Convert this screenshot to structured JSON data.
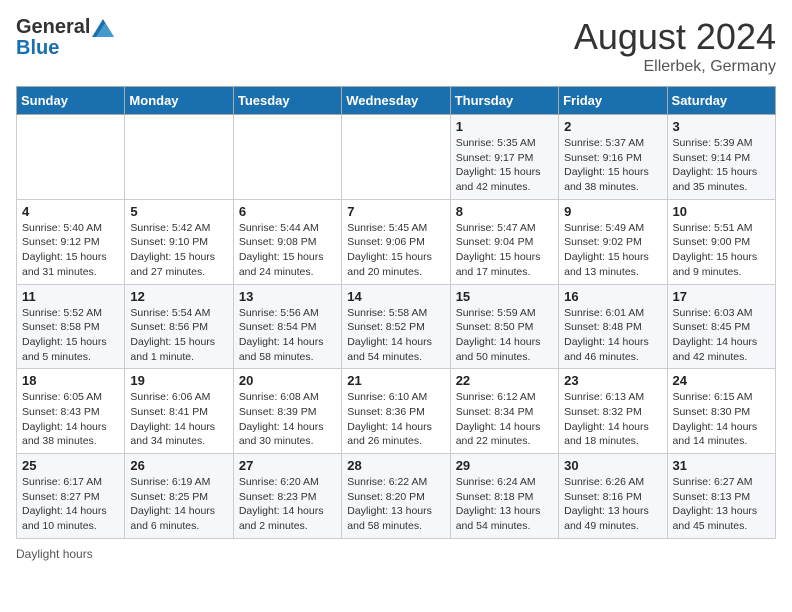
{
  "header": {
    "logo_general": "General",
    "logo_blue": "Blue",
    "month_year": "August 2024",
    "location": "Ellerbek, Germany"
  },
  "days_of_week": [
    "Sunday",
    "Monday",
    "Tuesday",
    "Wednesday",
    "Thursday",
    "Friday",
    "Saturday"
  ],
  "weeks": [
    [
      {
        "day": "",
        "info": ""
      },
      {
        "day": "",
        "info": ""
      },
      {
        "day": "",
        "info": ""
      },
      {
        "day": "",
        "info": ""
      },
      {
        "day": "1",
        "info": "Sunrise: 5:35 AM\nSunset: 9:17 PM\nDaylight: 15 hours and 42 minutes."
      },
      {
        "day": "2",
        "info": "Sunrise: 5:37 AM\nSunset: 9:16 PM\nDaylight: 15 hours and 38 minutes."
      },
      {
        "day": "3",
        "info": "Sunrise: 5:39 AM\nSunset: 9:14 PM\nDaylight: 15 hours and 35 minutes."
      }
    ],
    [
      {
        "day": "4",
        "info": "Sunrise: 5:40 AM\nSunset: 9:12 PM\nDaylight: 15 hours and 31 minutes."
      },
      {
        "day": "5",
        "info": "Sunrise: 5:42 AM\nSunset: 9:10 PM\nDaylight: 15 hours and 27 minutes."
      },
      {
        "day": "6",
        "info": "Sunrise: 5:44 AM\nSunset: 9:08 PM\nDaylight: 15 hours and 24 minutes."
      },
      {
        "day": "7",
        "info": "Sunrise: 5:45 AM\nSunset: 9:06 PM\nDaylight: 15 hours and 20 minutes."
      },
      {
        "day": "8",
        "info": "Sunrise: 5:47 AM\nSunset: 9:04 PM\nDaylight: 15 hours and 17 minutes."
      },
      {
        "day": "9",
        "info": "Sunrise: 5:49 AM\nSunset: 9:02 PM\nDaylight: 15 hours and 13 minutes."
      },
      {
        "day": "10",
        "info": "Sunrise: 5:51 AM\nSunset: 9:00 PM\nDaylight: 15 hours and 9 minutes."
      }
    ],
    [
      {
        "day": "11",
        "info": "Sunrise: 5:52 AM\nSunset: 8:58 PM\nDaylight: 15 hours and 5 minutes."
      },
      {
        "day": "12",
        "info": "Sunrise: 5:54 AM\nSunset: 8:56 PM\nDaylight: 15 hours and 1 minute."
      },
      {
        "day": "13",
        "info": "Sunrise: 5:56 AM\nSunset: 8:54 PM\nDaylight: 14 hours and 58 minutes."
      },
      {
        "day": "14",
        "info": "Sunrise: 5:58 AM\nSunset: 8:52 PM\nDaylight: 14 hours and 54 minutes."
      },
      {
        "day": "15",
        "info": "Sunrise: 5:59 AM\nSunset: 8:50 PM\nDaylight: 14 hours and 50 minutes."
      },
      {
        "day": "16",
        "info": "Sunrise: 6:01 AM\nSunset: 8:48 PM\nDaylight: 14 hours and 46 minutes."
      },
      {
        "day": "17",
        "info": "Sunrise: 6:03 AM\nSunset: 8:45 PM\nDaylight: 14 hours and 42 minutes."
      }
    ],
    [
      {
        "day": "18",
        "info": "Sunrise: 6:05 AM\nSunset: 8:43 PM\nDaylight: 14 hours and 38 minutes."
      },
      {
        "day": "19",
        "info": "Sunrise: 6:06 AM\nSunset: 8:41 PM\nDaylight: 14 hours and 34 minutes."
      },
      {
        "day": "20",
        "info": "Sunrise: 6:08 AM\nSunset: 8:39 PM\nDaylight: 14 hours and 30 minutes."
      },
      {
        "day": "21",
        "info": "Sunrise: 6:10 AM\nSunset: 8:36 PM\nDaylight: 14 hours and 26 minutes."
      },
      {
        "day": "22",
        "info": "Sunrise: 6:12 AM\nSunset: 8:34 PM\nDaylight: 14 hours and 22 minutes."
      },
      {
        "day": "23",
        "info": "Sunrise: 6:13 AM\nSunset: 8:32 PM\nDaylight: 14 hours and 18 minutes."
      },
      {
        "day": "24",
        "info": "Sunrise: 6:15 AM\nSunset: 8:30 PM\nDaylight: 14 hours and 14 minutes."
      }
    ],
    [
      {
        "day": "25",
        "info": "Sunrise: 6:17 AM\nSunset: 8:27 PM\nDaylight: 14 hours and 10 minutes."
      },
      {
        "day": "26",
        "info": "Sunrise: 6:19 AM\nSunset: 8:25 PM\nDaylight: 14 hours and 6 minutes."
      },
      {
        "day": "27",
        "info": "Sunrise: 6:20 AM\nSunset: 8:23 PM\nDaylight: 14 hours and 2 minutes."
      },
      {
        "day": "28",
        "info": "Sunrise: 6:22 AM\nSunset: 8:20 PM\nDaylight: 13 hours and 58 minutes."
      },
      {
        "day": "29",
        "info": "Sunrise: 6:24 AM\nSunset: 8:18 PM\nDaylight: 13 hours and 54 minutes."
      },
      {
        "day": "30",
        "info": "Sunrise: 6:26 AM\nSunset: 8:16 PM\nDaylight: 13 hours and 49 minutes."
      },
      {
        "day": "31",
        "info": "Sunrise: 6:27 AM\nSunset: 8:13 PM\nDaylight: 13 hours and 45 minutes."
      }
    ]
  ],
  "footer": {
    "daylight_label": "Daylight hours"
  }
}
